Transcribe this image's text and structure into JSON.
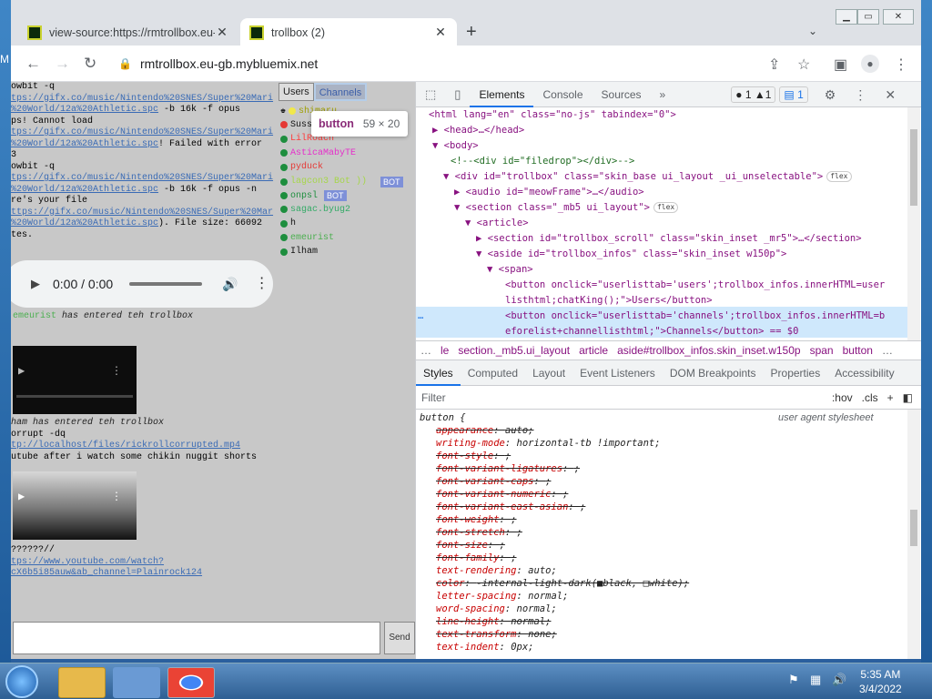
{
  "desktop": {
    "left_text": "M"
  },
  "browser": {
    "tabs": [
      {
        "title": "view-source:https://rmtrollbox.eu-",
        "active": false
      },
      {
        "title": "trollbox (2)",
        "active": true
      }
    ],
    "url": "rmtrollbox.eu-gb.mybluemix.net"
  },
  "page": {
    "chat_lines": [
      {
        "t": "owbit -q",
        "k": "plain"
      },
      {
        "t": "tps://gifx.co/music/Nintendo%20SNES/Super%20Mari",
        "k": "link"
      },
      {
        "t": "%20World/12a%20Athletic.spc -b 16k -f opus",
        "k": "mixed",
        "link": "%20World/12a%20Athletic.spc",
        "rest": " -b 16k -f opus"
      },
      {
        "t": "ps! Cannot load",
        "k": "plain"
      },
      {
        "t": "tps://gifx.co/music/Nintendo%20SNES/Super%20Mari",
        "k": "link"
      },
      {
        "t": "%20World/12a%20Athletic.spc! Failed with error",
        "k": "mixed",
        "link": "%20World/12a%20Athletic.spc",
        "rest": "! Failed with error"
      },
      {
        "t": "3",
        "k": "plain"
      },
      {
        "t": "owbit -q",
        "k": "plain"
      },
      {
        "t": "tps://gifx.co/music/Nintendo%20SNES/Super%20Mari",
        "k": "link"
      },
      {
        "t": "%20World/12a%20Athletic.spc -b 16k -f opus -n",
        "k": "mixed",
        "link": "%20World/12a%20Athletic.spc",
        "rest": " -b 16k -f opus -n"
      },
      {
        "t": "re's your file",
        "k": "plain"
      },
      {
        "t": "ttps://gifx.co/music/Nintendo%20SNES/Super%20Mar",
        "k": "link"
      },
      {
        "t": "%20World/12a%20Athletic.spc). File size: 66092",
        "k": "mixed",
        "link": "%20World/12a%20Athletic.spc",
        "rest": "). File size: 66092"
      },
      {
        "t": "tes.",
        "k": "plain"
      }
    ],
    "audio": {
      "time": "0:00 / 0:00"
    },
    "chat_after_audio": {
      "name": "emeurist",
      "text": " has entered teh trollbox"
    },
    "chat_block2": [
      {
        "t": "ham has entered teh trollbox",
        "k": "italic"
      },
      {
        "t": "orrupt -dq",
        "k": "plain"
      },
      {
        "t": "tp://localhost/files/rickrollcorrupted.mp4",
        "k": "link"
      },
      {
        "t": "utube after i watch some chikin nuggit shorts",
        "k": "plain"
      }
    ],
    "chat_block3": [
      {
        "t": "??????//",
        "k": "plain"
      },
      {
        "t": "tps://www.youtube.com/watch?",
        "k": "link"
      },
      {
        "t": "cX6b5i85auw&ab_channel=Plainrock124",
        "k": "link"
      }
    ],
    "users_tab_label": "Users",
    "channels_tab_label": "Channels",
    "users": [
      {
        "name": "shimaru",
        "dot": "#f1e84a",
        "color": "#9e9e00",
        "bot": false,
        "crown": true
      },
      {
        "name": "Sussy Bot",
        "dot": "#e53935",
        "color": "#111111",
        "bot": false
      },
      {
        "name": "LilRoach",
        "dot": "#1e8e3e",
        "color": "#ff3b3b",
        "bot": false
      },
      {
        "name": "AsticaMabyTE",
        "dot": "#1e8e3e",
        "color": "#e62ecb",
        "bot": false
      },
      {
        "name": "pyduck",
        "dot": "#1e8e3e",
        "color": "#e53935",
        "bot": false
      },
      {
        "name": "lagcon3 Bot ))",
        "dot": "#1e8e3e",
        "color": "#a6d64a",
        "bot": true
      },
      {
        "name": "onpsl",
        "dot": "#1e8e3e",
        "color": "#1e8e3e",
        "bot": true
      },
      {
        "name": "sagac.byug2",
        "dot": "#1e8e3e",
        "color": "#33aa66",
        "bot": false
      },
      {
        "name": "h",
        "dot": "#1e8e3e",
        "color": "#111111",
        "bot": false
      },
      {
        "name": "emeurist",
        "dot": "#1e8e3e",
        "color": "#4caf50",
        "bot": false
      },
      {
        "name": "Ilham",
        "dot": "#1e8e3e",
        "color": "#111111",
        "bot": false
      }
    ],
    "bot_label": "BOT",
    "send_label": "Send",
    "tooltip": {
      "tag": "button",
      "size": "59 × 20"
    }
  },
  "devtools": {
    "tabs": [
      "Elements",
      "Console",
      "Sources"
    ],
    "more": "»",
    "errors": "1",
    "warnings": "1",
    "issues": "1",
    "dom": {
      "html": "<html lang=\"en\" class=\"no-js\" tabindex=\"0\">",
      "head": "<head>…</head>",
      "body": "<body>",
      "comment": "<!--<div id=\"filedrop\"></div>-->",
      "div": "<div id=\"trollbox\" class=\"skin_base ui_layout _ui_unselectable\">",
      "audio": "<audio id=\"meowFrame\">…</audio>",
      "section": "<section class=\"_mb5 ui_layout\">",
      "article": "<article>",
      "section2": "<section id=\"trollbox_scroll\" class=\"skin_inset _mr5\">…</section>",
      "aside": "<aside id=\"trollbox_infos\" class=\"skin_inset w150p\">",
      "span": "<span>",
      "btn1a": "<button onclick=\"userlisttab='users';trollbox_infos.innerHTML=user",
      "btn1b": "listhtml;chatKing();\">Users</button>",
      "btn2a": "<button onclick=\"userlisttab='channels';trollbox_infos.innerHTML=b",
      "btn2b": "eforelist+channellisthtml;\">Channels</button> == $0",
      "flex": "flex",
      "dots": "…"
    },
    "crumbs": [
      "…",
      "le",
      "section._mb5.ui_layout",
      "article",
      "aside#trollbox_infos.skin_inset.w150p",
      "span",
      "button",
      "…"
    ],
    "style_tabs": [
      "Styles",
      "Computed",
      "Layout",
      "Event Listeners",
      "DOM Breakpoints",
      "Properties",
      "Accessibility"
    ],
    "filter_placeholder": "Filter",
    "hov": ":hov",
    "cls": ".cls",
    "rule_selector": "button {",
    "rule_source": "user agent stylesheet",
    "props": [
      {
        "n": "appearance",
        "v": "auto;",
        "s": true
      },
      {
        "n": "writing-mode",
        "v": "horizontal-tb !important;",
        "s": false
      },
      {
        "n": "font-style",
        "v": ";",
        "s": true
      },
      {
        "n": "font-variant-ligatures",
        "v": ";",
        "s": true
      },
      {
        "n": "font-variant-caps",
        "v": ";",
        "s": true
      },
      {
        "n": "font-variant-numeric",
        "v": ";",
        "s": true
      },
      {
        "n": "font-variant-east-asian",
        "v": ";",
        "s": true
      },
      {
        "n": "font-weight",
        "v": ";",
        "s": true
      },
      {
        "n": "font-stretch",
        "v": ";",
        "s": true
      },
      {
        "n": "font-size",
        "v": ";",
        "s": true
      },
      {
        "n": "font-family",
        "v": ";",
        "s": true
      },
      {
        "n": "text-rendering",
        "v": "auto;",
        "s": false
      },
      {
        "n": "color",
        "v": "-internal-light-dark(■black, □white);",
        "s": true
      },
      {
        "n": "letter-spacing",
        "v": "normal;",
        "s": false
      },
      {
        "n": "word-spacing",
        "v": "normal;",
        "s": false
      },
      {
        "n": "line-height",
        "v": "normal;",
        "s": true
      },
      {
        "n": "text-transform",
        "v": "none;",
        "s": true
      },
      {
        "n": "text-indent",
        "v": "0px;",
        "s": false
      }
    ]
  },
  "taskbar": {
    "time": "5:35 AM",
    "date": "3/4/2022"
  },
  "colors": {
    "accent": "#1a73e8",
    "taskbar": "#2e5f93"
  }
}
